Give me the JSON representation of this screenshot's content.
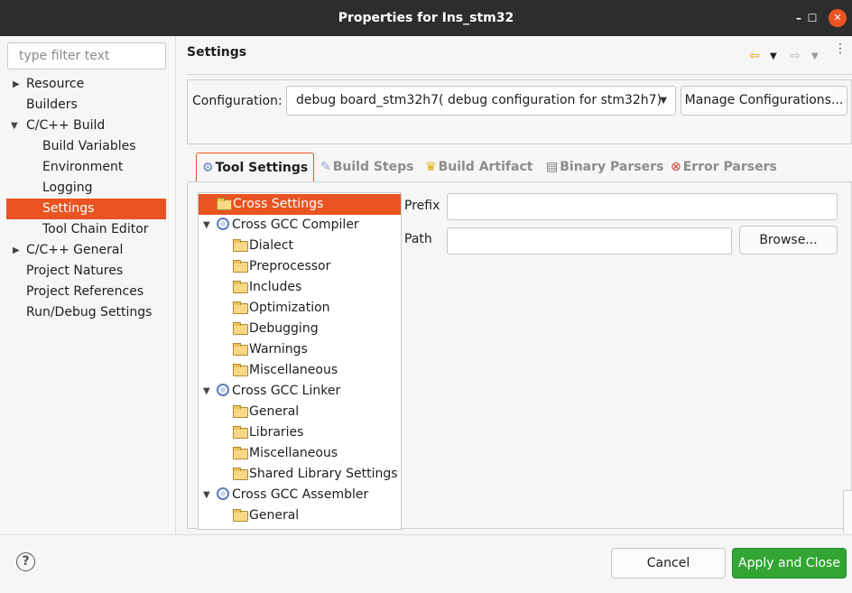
{
  "window": {
    "title": "Properties for Ins_stm32"
  },
  "filter": {
    "placeholder": "type filter text"
  },
  "nav": {
    "items": [
      {
        "label": "Resource",
        "expandable": true,
        "expanded": false
      },
      {
        "label": "Builders"
      },
      {
        "label": "C/C++ Build",
        "expandable": true,
        "expanded": true
      },
      {
        "label": "Build Variables"
      },
      {
        "label": "Environment"
      },
      {
        "label": "Logging"
      },
      {
        "label": "Settings",
        "selected": true
      },
      {
        "label": "Tool Chain Editor"
      },
      {
        "label": "C/C++ General",
        "expandable": true,
        "expanded": false
      },
      {
        "label": "Project Natures"
      },
      {
        "label": "Project References"
      },
      {
        "label": "Run/Debug Settings"
      }
    ]
  },
  "settings": {
    "title": "Settings",
    "config_label": "Configuration:",
    "config_value": "debug board_stm32h7( debug configuration for stm32h7)",
    "manage_label": "Manage Configurations..."
  },
  "tabs": [
    {
      "label": "Tool Settings",
      "active": true,
      "icon": "tool-settings-icon"
    },
    {
      "label": "Build Steps",
      "icon": "build-steps-icon"
    },
    {
      "label": "Build Artifact",
      "icon": "build-artifact-icon"
    },
    {
      "label": "Binary Parsers",
      "icon": "binary-parsers-icon"
    },
    {
      "label": "Error Parsers",
      "icon": "error-parsers-icon"
    }
  ],
  "tool_tree": {
    "items": [
      {
        "label": "Cross Settings",
        "icon": "folder",
        "selected": true
      },
      {
        "label": "Cross GCC Compiler",
        "icon": "gear",
        "expanded": true
      },
      {
        "label": "Dialect",
        "icon": "folder"
      },
      {
        "label": "Preprocessor",
        "icon": "folder"
      },
      {
        "label": "Includes",
        "icon": "folder"
      },
      {
        "label": "Optimization",
        "icon": "folder"
      },
      {
        "label": "Debugging",
        "icon": "folder"
      },
      {
        "label": "Warnings",
        "icon": "folder"
      },
      {
        "label": "Miscellaneous",
        "icon": "folder"
      },
      {
        "label": "Cross GCC Linker",
        "icon": "gear",
        "expanded": true
      },
      {
        "label": "General",
        "icon": "folder"
      },
      {
        "label": "Libraries",
        "icon": "folder"
      },
      {
        "label": "Miscellaneous",
        "icon": "folder"
      },
      {
        "label": "Shared Library Settings",
        "icon": "folder"
      },
      {
        "label": "Cross GCC Assembler",
        "icon": "gear",
        "expanded": true
      },
      {
        "label": "General",
        "icon": "folder"
      }
    ]
  },
  "fields": {
    "prefix_label": "Prefix",
    "prefix_value": "",
    "path_label": "Path",
    "path_value": "",
    "browse_label": "Browse..."
  },
  "buttons": {
    "cancel": "Cancel",
    "apply": "Apply and Close"
  },
  "colors": {
    "accent": "#e95420",
    "apply": "#33a532",
    "titlebar": "#2d2d2d"
  }
}
